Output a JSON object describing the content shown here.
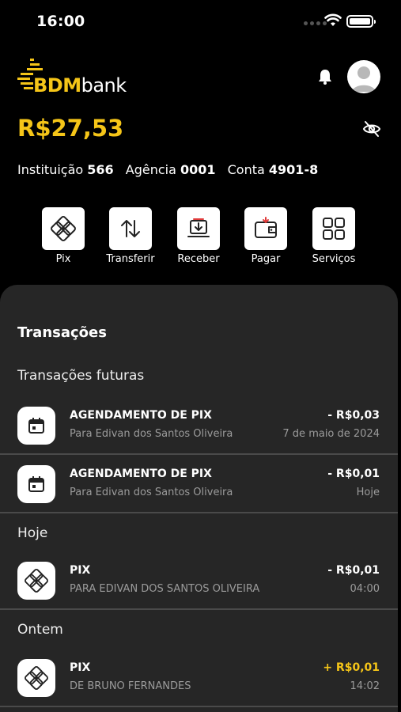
{
  "status_bar": {
    "time": "16:00"
  },
  "brand": {
    "name_bold": "BDM",
    "name_regular": "bank",
    "accent_color": "#F5C518"
  },
  "balance": "R$27,53",
  "account": {
    "institution_label": "Instituição",
    "institution_value": "566",
    "agency_label": "Agência",
    "agency_value": "0001",
    "account_label": "Conta",
    "account_value": "4901-8"
  },
  "actions": [
    {
      "label": "Pix",
      "icon": "pix-icon"
    },
    {
      "label": "Transferir",
      "icon": "transfer-icon"
    },
    {
      "label": "Receber",
      "icon": "receive-icon"
    },
    {
      "label": "Pagar",
      "icon": "wallet-icon"
    },
    {
      "label": "Serviços",
      "icon": "grid-icon"
    }
  ],
  "transactions": {
    "title": "Transações",
    "sections": [
      {
        "label": "Transações futuras",
        "items": [
          {
            "name": "AGENDAMENTO DE PIX",
            "sub": "Para Edivan dos Santos Oliveira",
            "amount": "- R$0,03",
            "date": "7 de maio de 2024",
            "icon": "calendar-icon"
          },
          {
            "name": "AGENDAMENTO DE PIX",
            "sub": "Para Edivan dos Santos Oliveira",
            "amount": "- R$0,01",
            "date": "Hoje",
            "icon": "calendar-icon"
          }
        ]
      },
      {
        "label": "Hoje",
        "items": [
          {
            "name": "PIX",
            "sub": "PARA EDIVAN DOS SANTOS OLIVEIRA",
            "amount": "- R$0,01",
            "date": "04:00",
            "icon": "pix-icon"
          }
        ]
      },
      {
        "label": "Ontem",
        "items": [
          {
            "name": "PIX",
            "sub": "DE BRUNO FERNANDES",
            "amount": "+ R$0,01",
            "date": "14:02",
            "icon": "pix-icon"
          }
        ]
      }
    ]
  }
}
